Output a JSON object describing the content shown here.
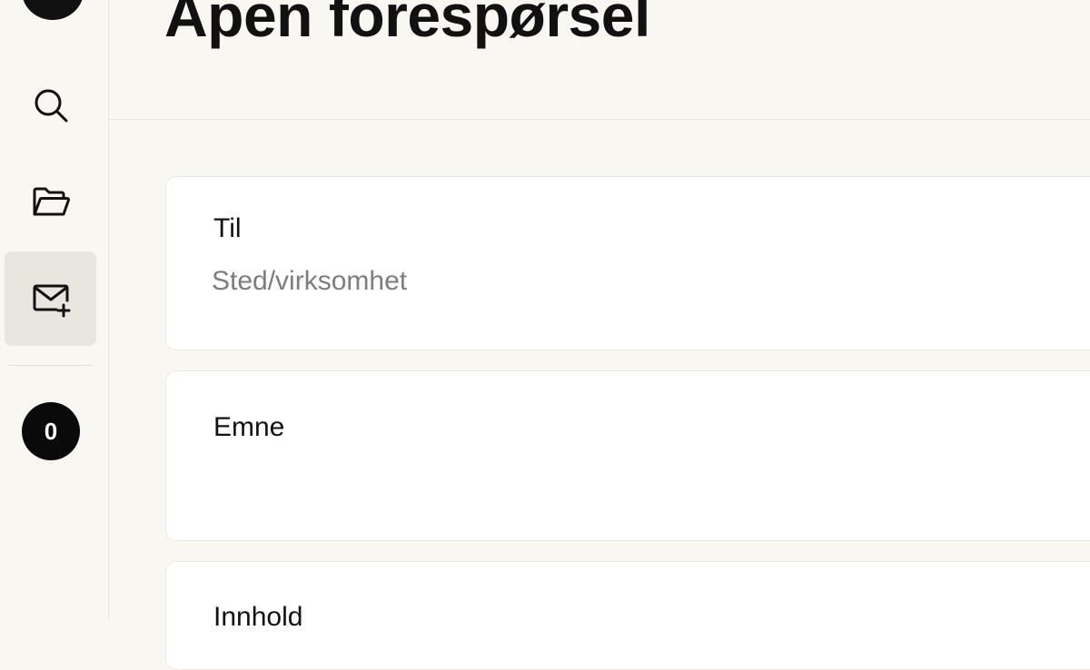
{
  "sidebar": {
    "logo_icon": "logo-circle",
    "items": [
      {
        "name": "search",
        "icon": "search-icon"
      },
      {
        "name": "folder",
        "icon": "folder-open-icon"
      },
      {
        "name": "new-request",
        "icon": "mail-plus-icon",
        "active": true
      }
    ],
    "badge_count": "0"
  },
  "header": {
    "title": "Åpen forespørsel"
  },
  "form": {
    "to": {
      "label": "Til",
      "placeholder": "Sted/virksomhet",
      "value": ""
    },
    "subject": {
      "label": "Emne",
      "value": ""
    },
    "content": {
      "label": "Innhold"
    }
  },
  "colors": {
    "background": "#f9f7f1",
    "card": "#ffffff",
    "active_nav": "#e8e6df",
    "text": "#111111",
    "placeholder": "#7d7d7d"
  }
}
